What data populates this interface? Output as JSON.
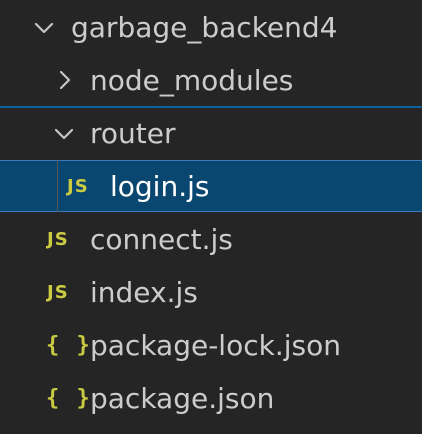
{
  "explorer": {
    "root": {
      "label": "garbage_backend4",
      "expanded": true,
      "icon": "chevron-down-icon"
    },
    "items": [
      {
        "label": "node_modules",
        "type": "folder",
        "expanded": false,
        "icon": "chevron-right-icon"
      },
      {
        "label": "router",
        "type": "folder",
        "expanded": true,
        "icon": "chevron-down-icon"
      },
      {
        "label": "login.js",
        "type": "file",
        "file_icon": "JS",
        "selected": true
      },
      {
        "label": "connect.js",
        "type": "file",
        "file_icon": "JS"
      },
      {
        "label": "index.js",
        "type": "file",
        "file_icon": "JS"
      },
      {
        "label": "package-lock.json",
        "type": "file",
        "file_icon": "{ }"
      },
      {
        "label": "package.json",
        "type": "file",
        "file_icon": "{ }"
      }
    ]
  },
  "colors": {
    "background": "#252526",
    "text": "#cccccc",
    "selected_background": "#094771",
    "focus_border": "#0e639c",
    "js_icon": "#cbcb41",
    "json_icon": "#cbcb41"
  }
}
